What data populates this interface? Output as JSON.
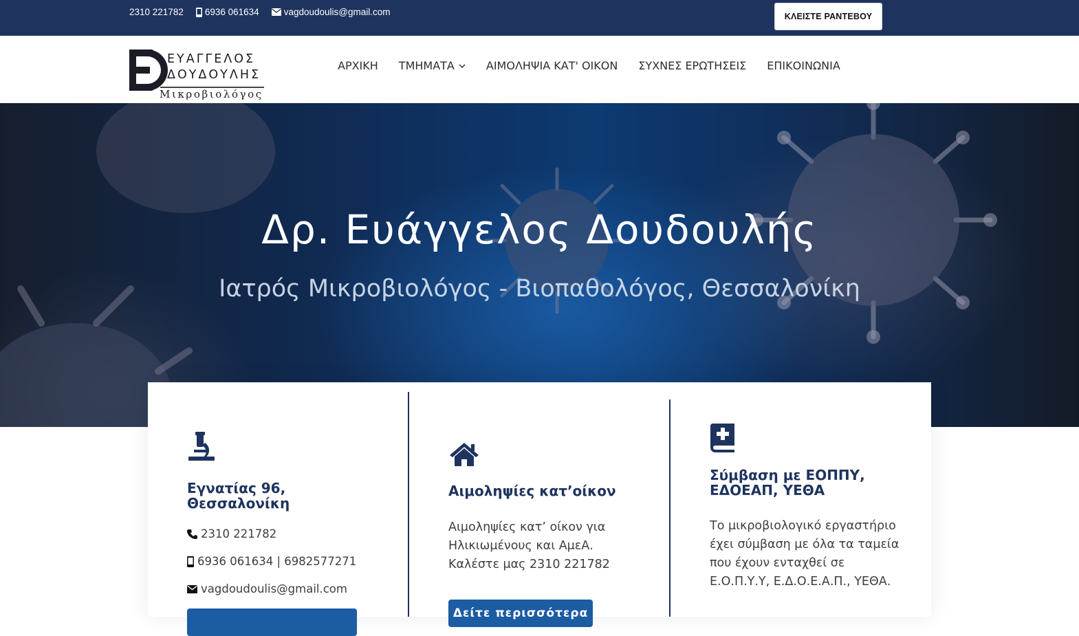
{
  "topbar": {
    "phone": "2310 221782",
    "mobile": "6936 061634",
    "email": "vagdoudoulis@gmail.com",
    "cta_label": "ΚΛΕΙΣΤΕ ΡΑΝΤΕΒΟΥ"
  },
  "logo": {
    "line1": "ΕΥΑΓΓΕΛΟΣ",
    "line2": "ΔΟΥΔΟΥΛΗΣ",
    "line3": "Μικροβιολόγος"
  },
  "nav": {
    "items": [
      {
        "label": "ΑΡΧΙΚΗ"
      },
      {
        "label": "ΤΜΗΜΑΤΑ"
      },
      {
        "label": "ΑΙΜΟΛΗΨΙΑ ΚΑΤ' ΟΙΚΟΝ"
      },
      {
        "label": "ΣΥΧΝΕΣ ΕΡΩΤΗΣΕΙΣ"
      },
      {
        "label": "ΕΠΙΚΟΙΝΩΝΙΑ"
      }
    ]
  },
  "hero": {
    "title": "Δρ. Ευάγγελος Δουδουλής",
    "subtitle": "Ιατρός Μικροβιολόγος - Βιοπαθολόγος, Θεσσαλονίκη"
  },
  "cards": {
    "address": {
      "title_line1": "Εγνατίας 96,",
      "title_line2": "Θεσσαλονίκη",
      "phone": "2310 221782",
      "mobiles": "6936 061634 | 6982577271",
      "email": "vagdoudoulis@gmail.com"
    },
    "home_service": {
      "title": "Αιμοληψίες κατ’οίκον",
      "text": "Αιμοληψίες κατ’ οίκον για Ηλικιωμένους και ΑμεΑ. Καλέστε μας 2310 221782",
      "button": "Δείτε περισσότερα"
    },
    "contract": {
      "title_line1": "Σύμβαση με ΕΟΠΠΥ,",
      "title_line2": "ΕΔΟΕΑΠ, ΥΕΘΑ",
      "text": "Το μικροβιολογικό εργαστήριο έχει σύμβαση με όλα τα ταμεία που έχουν ενταχθεί σε Ε.Ο.Π.Υ.Υ, Ε.Δ.Ο.Ε.Α.Π., ΥΕΘΑ."
    }
  },
  "colors": {
    "navy": "#1e335e",
    "button_blue": "#1b5ca3"
  }
}
